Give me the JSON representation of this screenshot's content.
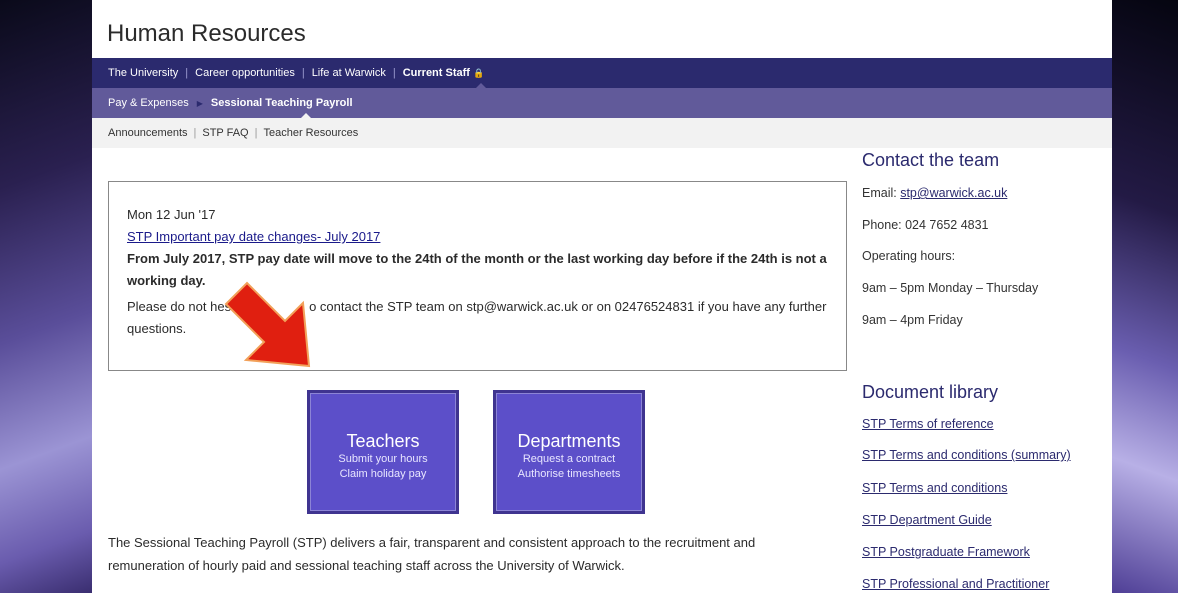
{
  "site": {
    "title": "Human Resources"
  },
  "topnav": {
    "items": [
      "The University",
      "Career opportunities",
      "Life at Warwick",
      "Current Staff"
    ]
  },
  "subnav": {
    "parent": "Pay & Expenses",
    "current": "Sessional Teaching Payroll"
  },
  "tertnav": {
    "items": [
      "Announcements",
      "STP FAQ",
      "Teacher Resources"
    ]
  },
  "announcement": {
    "date": "Mon 12 Jun '17",
    "link": "STP Important pay date changes- July 2017",
    "bold_text": "From July 2017, STP pay date will move to the 24th of the month or the last working day before if the 24th is not a working day.",
    "body_start": "Please do not hes",
    "body_end": "o contact the STP team on stp@warwick.ac.uk or on 02476524831 if you have any further questions."
  },
  "tiles": {
    "teachers": {
      "title": "Teachers",
      "line1": "Submit your hours",
      "line2": "Claim holiday pay"
    },
    "departments": {
      "title": "Departments",
      "line1": "Request a contract",
      "line2": "Authorise timesheets"
    }
  },
  "intro": {
    "text": "The Sessional Teaching Payroll (STP) delivers a fair, transparent and consistent approach to the recruitment and remuneration of hourly paid and sessional teaching staff across the University of Warwick."
  },
  "contact": {
    "heading": "Contact the team",
    "email_label": "Email: ",
    "email": "stp@warwick.ac.uk",
    "phone": "Phone: 024 7652 4831",
    "hours_label": "Operating hours:",
    "hours1": "9am – 5pm Monday – Thursday",
    "hours2": "9am – 4pm Friday"
  },
  "documents": {
    "heading": "Document library",
    "links": [
      "STP Terms of reference",
      "STP Terms and conditions (summary)",
      "STP Terms and conditions",
      "STP Department Guide",
      "STP Postgraduate Framework",
      "STP Professional and Practitioner"
    ]
  },
  "colors": {
    "nav_dark": "#2b2a6e",
    "nav_mid": "#615a9a",
    "tile": "#5c4fc9",
    "arrow": "#e01f10"
  }
}
